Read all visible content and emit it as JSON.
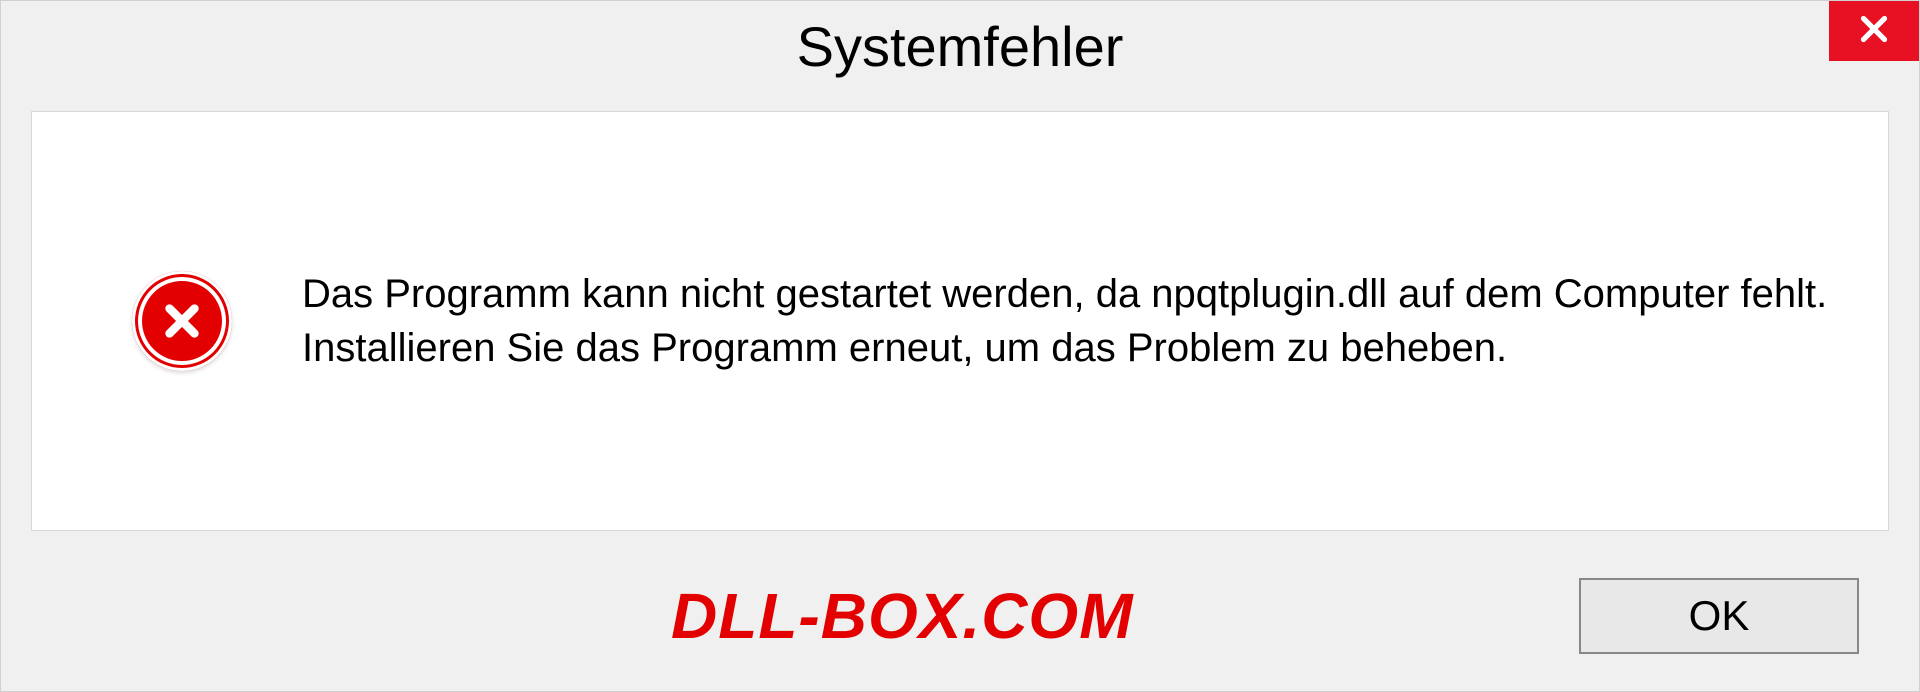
{
  "dialog": {
    "title": "Systemfehler",
    "message": "Das Programm kann nicht gestartet werden, da npqtplugin.dll auf dem Computer fehlt. Installieren Sie das Programm erneut, um das Problem zu beheben.",
    "ok_label": "OK"
  },
  "watermark": "DLL-BOX.COM",
  "icons": {
    "close": "close-icon",
    "error": "error-circle-icon"
  }
}
